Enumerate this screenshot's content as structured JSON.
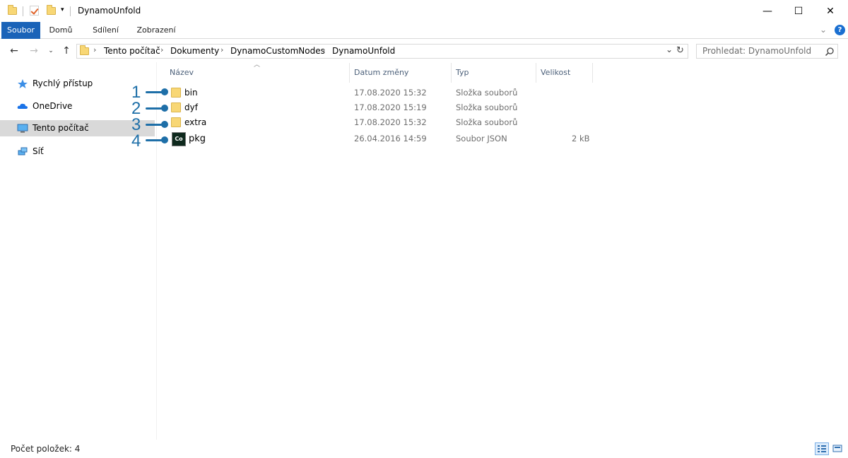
{
  "window": {
    "title": "DynamoUnfold",
    "controls": {
      "minimize": "—",
      "maximize": "☐",
      "close": "✕"
    }
  },
  "ribbon": {
    "tabs": [
      {
        "label": "Soubor",
        "active": true
      },
      {
        "label": "Domů"
      },
      {
        "label": "Sdílení"
      },
      {
        "label": "Zobrazení"
      }
    ],
    "help": "?"
  },
  "address": {
    "breadcrumb": [
      "Tento počítač",
      "Dokumenty",
      "DynamoCustomNodes",
      "DynamoUnfold"
    ]
  },
  "search": {
    "placeholder": "Prohledat: DynamoUnfold"
  },
  "sidebar": {
    "items": [
      {
        "label": "Rychlý přístup",
        "icon": "star-icon"
      },
      {
        "label": "OneDrive",
        "icon": "cloud-icon"
      },
      {
        "label": "Tento počítač",
        "icon": "computer-icon",
        "selected": true
      },
      {
        "label": "Síť",
        "icon": "network-icon"
      }
    ]
  },
  "columns": [
    "Název",
    "Datum změny",
    "Typ",
    "Velikost"
  ],
  "files": [
    {
      "name": "bin",
      "date": "17.08.2020 15:32",
      "type": "Složka souborů",
      "size": "",
      "icon": "folder-icon"
    },
    {
      "name": "dyf",
      "date": "17.08.2020 15:19",
      "type": "Složka souborů",
      "size": "",
      "icon": "folder-icon"
    },
    {
      "name": "extra",
      "date": "17.08.2020 15:32",
      "type": "Složka souborů",
      "size": "",
      "icon": "folder-icon"
    },
    {
      "name": "pkg",
      "date": "26.04.2016 14:59",
      "type": "Soubor JSON",
      "size": "2 kB",
      "icon": "json-file-icon",
      "icon_text": "Co"
    }
  ],
  "callouts": [
    "1",
    "2",
    "3",
    "4"
  ],
  "status": {
    "count": "Počet položek: 4"
  },
  "colors": {
    "accent": "#1a63b8",
    "callout": "#1e6fa8",
    "folder": "#f8d775",
    "selection": "#d9d9d9"
  }
}
